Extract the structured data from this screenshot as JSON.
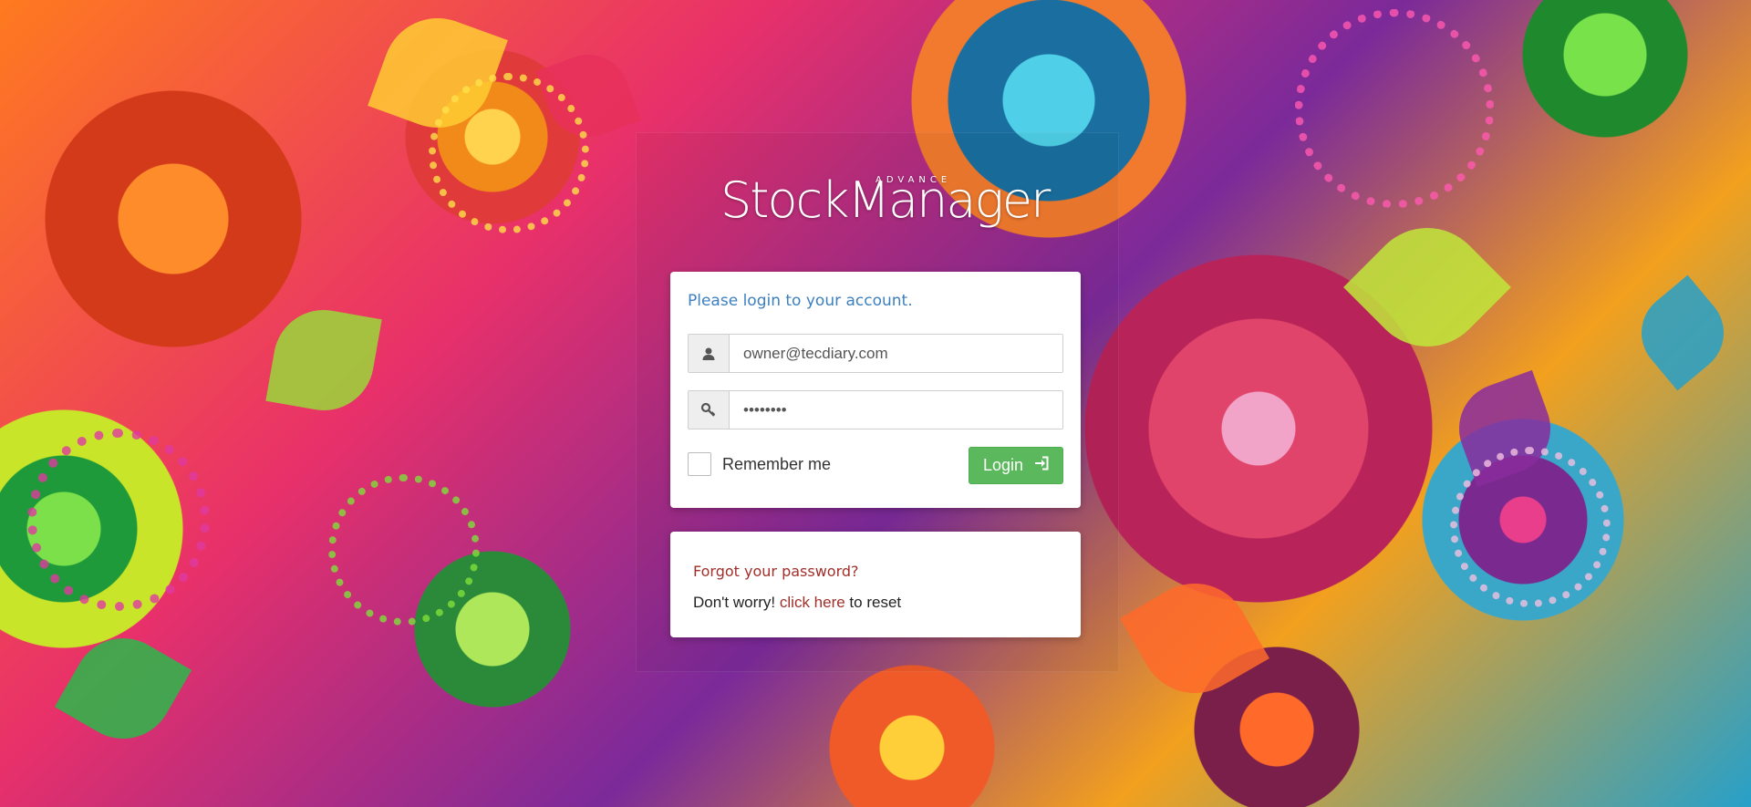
{
  "brand": {
    "logo_main": "StockManager",
    "logo_sup": "ADVANCE"
  },
  "login": {
    "prompt": "Please login to your account.",
    "email_value": "owner@tecdiary.com",
    "password_value": "********",
    "remember_label": "Remember me",
    "login_label": "Login",
    "icons": {
      "email": "user-icon",
      "password": "key-icon",
      "login": "sign-in-icon"
    }
  },
  "forgot": {
    "title": "Forgot your password?",
    "prefix": "Don't worry! ",
    "link_text": "click here",
    "suffix": " to reset"
  },
  "colors": {
    "prompt": "#3c80c0",
    "login_button": "#5cb85c",
    "forgot_link": "#a0302a"
  }
}
